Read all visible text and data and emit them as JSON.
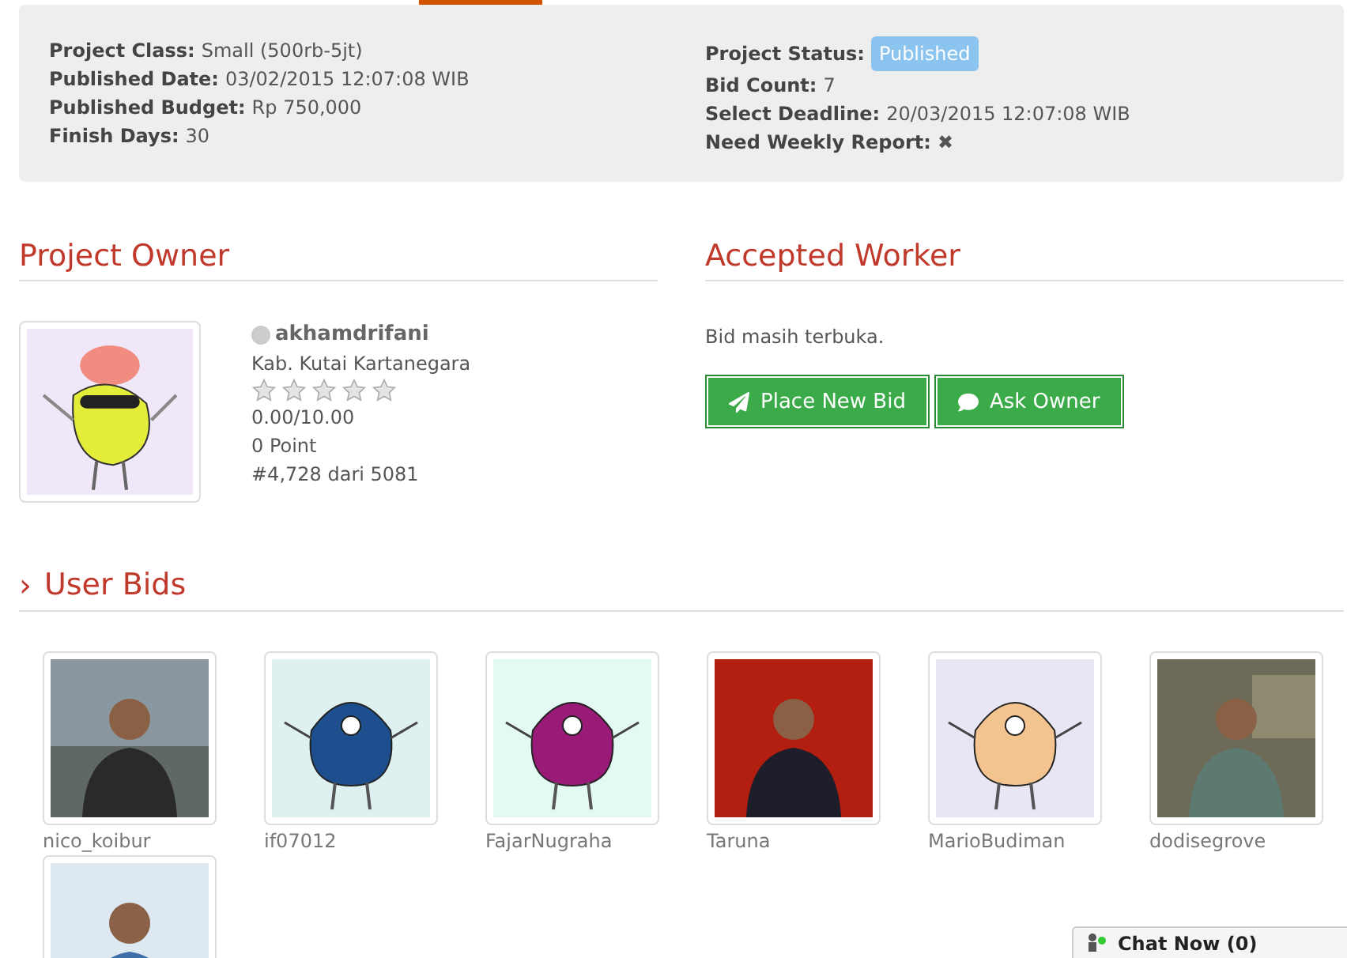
{
  "details": {
    "left": [
      {
        "label": "Project Class:",
        "value": "Small (500rb-5jt)"
      },
      {
        "label": "Published Date:",
        "value": "03/02/2015 12:07:08 WIB"
      },
      {
        "label": "Published Budget:",
        "value": "Rp 750,000"
      },
      {
        "label": "Finish Days:",
        "value": "30"
      }
    ],
    "right": [
      {
        "label": "Project Status:",
        "value": "Published",
        "kind": "badge"
      },
      {
        "label": "Bid Count:",
        "value": "7",
        "kind": "text"
      },
      {
        "label": "Select Deadline:",
        "value": "20/03/2015 12:07:08 WIB",
        "kind": "text"
      },
      {
        "label": "Need Weekly Report:",
        "value": "✖",
        "kind": "text"
      }
    ]
  },
  "owner": {
    "heading": "Project Owner",
    "username": "akhamdrifani",
    "online": false,
    "location": "Kab. Kutai Kartanegara",
    "stars": 0,
    "rating": "0.00/10.00",
    "points": "0 Point",
    "rank": "#4,728 dari 5081"
  },
  "worker": {
    "heading": "Accepted Worker",
    "message": "Bid masih terbuka.",
    "buttons": [
      {
        "label": "Place New Bid",
        "kind": "send"
      },
      {
        "label": "Ask Owner",
        "kind": "chat"
      }
    ]
  },
  "bids": {
    "heading": "User Bids",
    "toggle": "›",
    "users": [
      {
        "name": "nico_koibur",
        "kind": "picture"
      },
      {
        "name": "if07012",
        "kind": "picture"
      },
      {
        "name": "FajarNugraha",
        "kind": "picture"
      },
      {
        "name": "Taruna",
        "kind": "picture"
      },
      {
        "name": "MarioBudiman",
        "kind": "picture"
      },
      {
        "name": "dodisegrove",
        "kind": "picture"
      },
      {
        "kind": "picture"
      }
    ]
  },
  "chat": {
    "label": "Chat Now (0)"
  }
}
